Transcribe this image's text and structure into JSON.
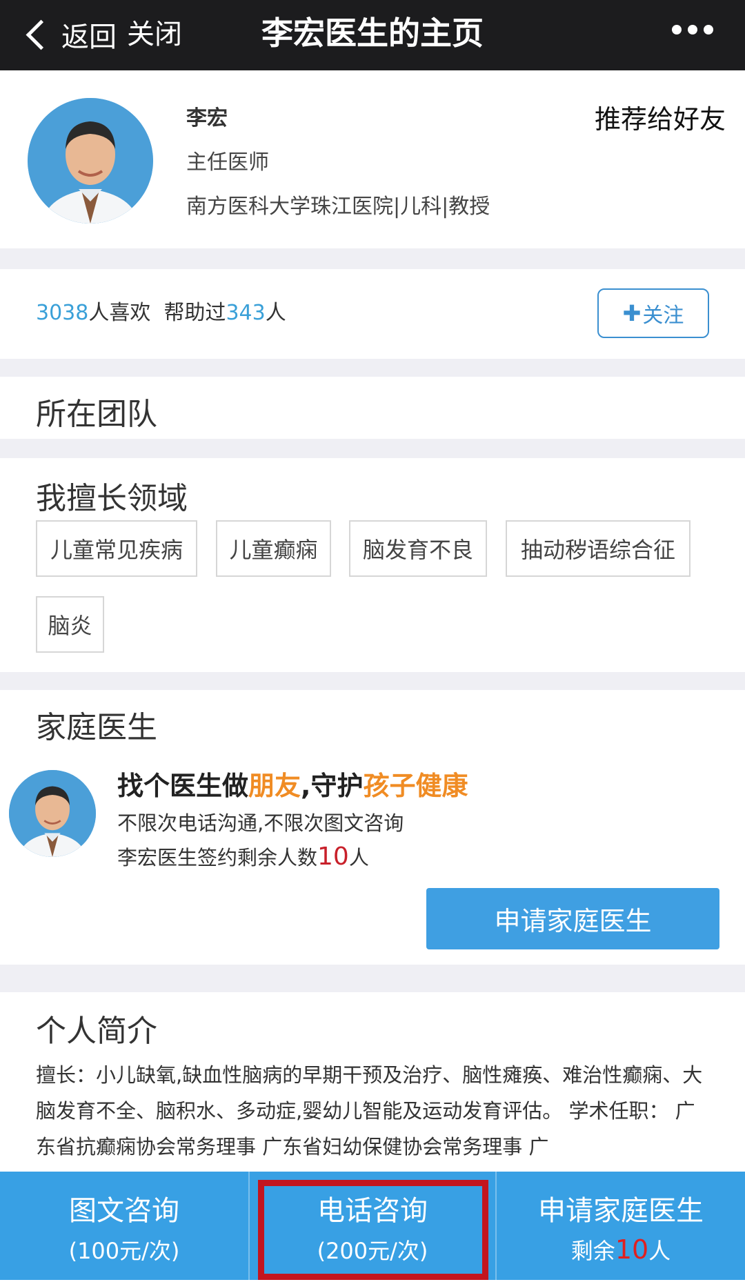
{
  "topbar": {
    "back_label": "返回",
    "close_label": "关闭",
    "title": "李宏医生的主页"
  },
  "profile": {
    "name": "李宏",
    "title": "主任医师",
    "organization": "南方医科大学珠江医院|儿科|教授",
    "recommend_label": "推荐给好友"
  },
  "stats": {
    "likes_count": "3038",
    "likes_suffix": "人喜欢",
    "helped_prefix": "帮助过",
    "helped_count": "343",
    "helped_suffix": "人",
    "follow_plus": "✚",
    "follow_label": "关注"
  },
  "team": {
    "heading": "所在团队"
  },
  "specialties": {
    "heading": "我擅长领域",
    "tags": [
      "儿童常见疾病",
      "儿童癫痫",
      "脑发育不良",
      "抽动秽语综合征",
      "脑炎"
    ]
  },
  "family_doctor": {
    "heading": "家庭医生",
    "headline_part1": "找个医生做",
    "headline_part2": "朋友",
    "headline_part3": ",守护",
    "headline_part4": "孩子健康",
    "line1": "不限次电话沟通,不限次图文咨询",
    "line2_prefix": "李宏医生签约剩余人数",
    "remaining": "10",
    "line2_suffix": "人",
    "apply_button": "申请家庭医生"
  },
  "bio": {
    "heading": "个人简介",
    "text": "擅长：小儿缺氧,缺血性脑病的早期干预及治疗、脑性瘫痪、难治性癫痫、大脑发育不全、脑积水、多动症,婴幼儿智能及运动发育评估。 学术任职： 广东省抗癫痫协会常务理事 广东省妇幼保健协会常务理事 广"
  },
  "bottom_bar": {
    "text_consult": {
      "label": "图文咨询",
      "price": "(100元/次)"
    },
    "phone_consult": {
      "label": "电话咨询",
      "price": "(200元/次)"
    },
    "family_doctor": {
      "label": "申请家庭医生",
      "remaining_prefix": "剩余",
      "remaining": "10",
      "remaining_suffix": "人"
    }
  },
  "colors": {
    "accent_blue": "#38a0e4",
    "highlight_red": "#c3151f",
    "orange": "#f08c24",
    "number_blue": "#3aa0d8"
  }
}
